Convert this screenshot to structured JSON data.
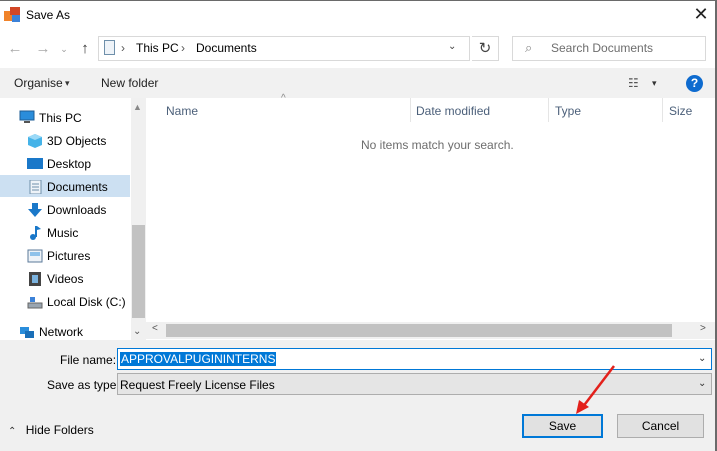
{
  "window": {
    "title": "Save As",
    "close_glyph": "✕"
  },
  "address": {
    "back_glyph": "←",
    "forward_glyph": "→",
    "recent_glyph": "⌄",
    "up_glyph": "↑",
    "sep": "›",
    "crumbs": [
      "This PC",
      "Documents"
    ],
    "dropdown_glyph": "⌄",
    "refresh_glyph": "↻",
    "search_placeholder": "Search Documents",
    "search_icon": "⌕"
  },
  "commands": {
    "organise": "Organise",
    "organise_arrow": "▾",
    "new_folder": "New folder",
    "view_icon": "☷",
    "view_arrow": "▾",
    "help": "?"
  },
  "nav": {
    "items": [
      {
        "label": "This PC",
        "icon": "this-pc-icon"
      },
      {
        "label": "3D Objects",
        "icon": "3d-objects-icon"
      },
      {
        "label": "Desktop",
        "icon": "desktop-icon"
      },
      {
        "label": "Documents",
        "icon": "documents-icon",
        "selected": true
      },
      {
        "label": "Downloads",
        "icon": "downloads-icon"
      },
      {
        "label": "Music",
        "icon": "music-icon"
      },
      {
        "label": "Pictures",
        "icon": "pictures-icon"
      },
      {
        "label": "Videos",
        "icon": "videos-icon"
      },
      {
        "label": "Local Disk (C:)",
        "icon": "local-disk-icon"
      },
      {
        "label": "Network",
        "icon": "network-icon"
      }
    ],
    "scroll_up": "▲",
    "scroll_down": "⌄"
  },
  "files": {
    "columns": [
      "Name",
      "Date modified",
      "Type",
      "Size"
    ],
    "sort_glyph": "^",
    "empty_message": "No items match your search.",
    "scroll_left": "<",
    "scroll_right": ">"
  },
  "form": {
    "file_name_label": "File name:",
    "file_name_value": "APPROVALPUGININTERNS",
    "save_as_type_label": "Save as type:",
    "save_as_type_value": "Request Freely License Files",
    "arrow_glyph": "⌄"
  },
  "footer": {
    "hide_folders": "Hide Folders",
    "save": "Save",
    "cancel": "Cancel"
  },
  "colors": {
    "accent": "#0078d7",
    "selection": "#cce0f2",
    "annotation_arrow": "#e3201b"
  }
}
